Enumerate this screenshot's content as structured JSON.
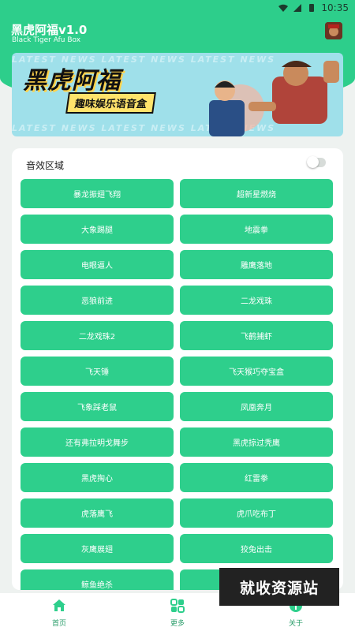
{
  "status_bar": {
    "time": "10:35"
  },
  "header": {
    "title": "黑虎阿福v1.0",
    "subtitle": "Black Tiger Afu Box"
  },
  "banner": {
    "title": "黑虎阿福",
    "subtitle": "趣味娱乐语音盒",
    "news_text": "LATEST NEWS   LATEST NEWS   LATEST NEWS"
  },
  "section": {
    "label": "音效区域",
    "toggle_on": false
  },
  "sound_buttons": [
    "暴龙振翅飞翔",
    "超新星燃烧",
    "大象踢腿",
    "地震拳",
    "电眼逼人",
    "雕鹰落地",
    "恶狼前进",
    "二龙戏珠",
    "二龙戏珠2",
    "飞鹤捕虾",
    "飞天锤",
    "飞天猴巧夺宝盒",
    "飞象踩老鼠",
    "凤凰奔月",
    "还有弗拉明戈舞步",
    "黑虎掠过秃鹰",
    "黑虎掏心",
    "红雷拳",
    "虎落鹰飞",
    "虎爪吃布丁",
    "灰鹰展翅",
    "狡兔出击",
    "鲸鱼绝杀",
    ""
  ],
  "bottom_nav": [
    {
      "label": "首页",
      "icon": "home-icon"
    },
    {
      "label": "更多",
      "icon": "apps-icon"
    },
    {
      "label": "关于",
      "icon": "info-icon"
    }
  ],
  "watermark": "就收资源站",
  "colors": {
    "accent": "#2dce8b",
    "button": "#2ecf8c",
    "nav_label": "#2a9d6a"
  }
}
